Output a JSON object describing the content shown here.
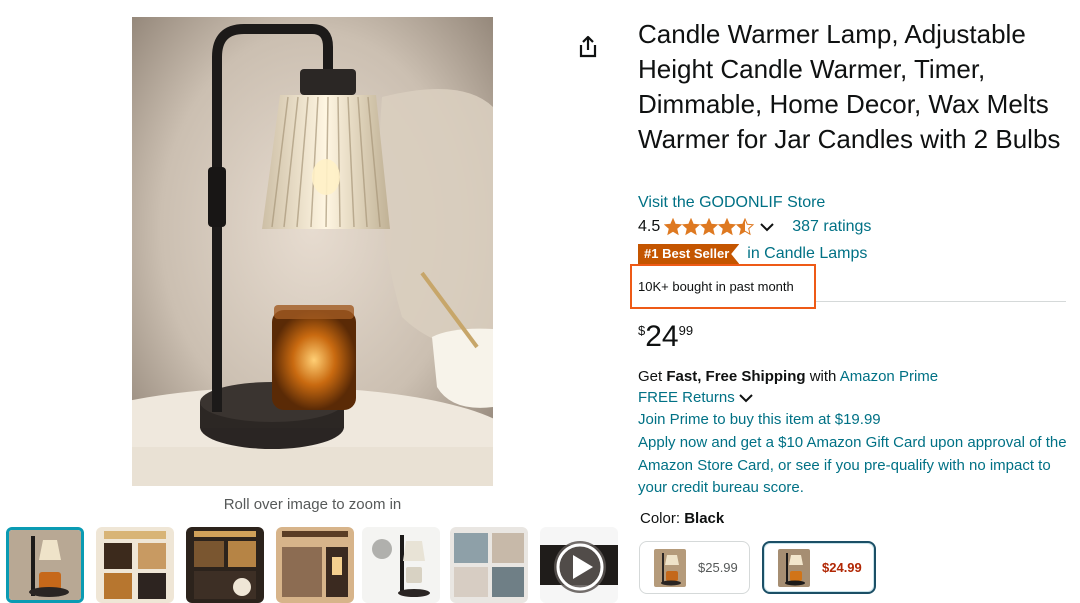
{
  "product": {
    "title": "Candle Warmer Lamp, Adjustable Height Candle Warmer, Timer, Dimmable, Home Decor, Wax Melts Warmer for Jar Candles with 2 Bulbs",
    "store_link": "Visit the GODONLIF Store",
    "rating_value": "4.5",
    "rating_stars": 4.5,
    "ratings_count": "387 ratings",
    "badge": "#1 Best Seller",
    "badge_category": "in Candle Lamps",
    "bought_past_month": "10K+ bought in past month"
  },
  "price": {
    "symbol": "$",
    "whole": "24",
    "fraction": "99"
  },
  "shipping": {
    "get_prefix": "Get",
    "fast_free": "Fast, Free Shipping",
    "with": "with",
    "prime_link": "Amazon Prime",
    "free_returns": "FREE Returns",
    "join_prime": "Join Prime to buy this item at $19.99",
    "gift_card_offer": "Apply now and get a $10 Amazon Gift Card upon approval of the Amazon Store Card, or see if you pre-qualify with no impact to your credit bureau score."
  },
  "image": {
    "zoom_hint": "Roll over image to zoom in"
  },
  "color": {
    "label": "Color:",
    "selected": "Black",
    "options": [
      {
        "price": "$25.99",
        "selected": false
      },
      {
        "price": "$24.99",
        "selected": true
      }
    ]
  },
  "icons": {
    "share": "share-icon",
    "star": "star-icon",
    "chevron": "chevron-down-icon",
    "play": "play-icon"
  },
  "colors": {
    "link": "#007185",
    "badge": "#C45500",
    "star": "#DE7921",
    "price_red": "#B12704",
    "highlight_box": "#ee5a16",
    "thumb_selected": "#0a9bb3"
  }
}
